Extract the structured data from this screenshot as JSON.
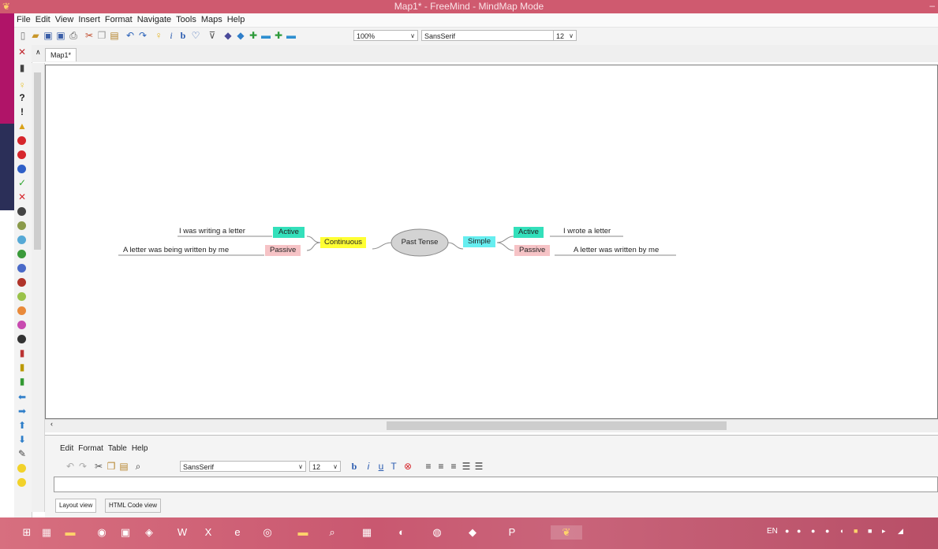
{
  "window": {
    "title": "Map1* - FreeMind - MindMap Mode"
  },
  "menubar": [
    "File",
    "Edit",
    "View",
    "Insert",
    "Format",
    "Navigate",
    "Tools",
    "Maps",
    "Help"
  ],
  "toolbar": {
    "zoom": "100%",
    "font_family": "SansSerif",
    "font_size": "12"
  },
  "tabs": {
    "active": "Map1*"
  },
  "mindmap": {
    "root": "Past Tense",
    "left": {
      "branch": "Continuous",
      "active": "Active",
      "passive": "Passive",
      "active_example": "I was writing a letter",
      "passive_example": "A letter was being written by me"
    },
    "right": {
      "branch": "Simple",
      "active": "Active",
      "passive": "Passive",
      "active_example": "I wrote a letter",
      "passive_example": "A letter was written by me"
    },
    "colors": {
      "active": "#33e0bb",
      "passive": "#f6c3c6",
      "continuous": "#ffff33",
      "simple": "#66eef0",
      "root": "#d3d3d3",
      "line": "#8a8a8a"
    }
  },
  "editor": {
    "menu": [
      "Edit",
      "Format",
      "Table",
      "Help"
    ],
    "font_family": "SansSerif",
    "font_size": "12",
    "tabs": [
      "Layout view",
      "HTML Code view"
    ]
  },
  "taskbar": {
    "language": "EN"
  }
}
